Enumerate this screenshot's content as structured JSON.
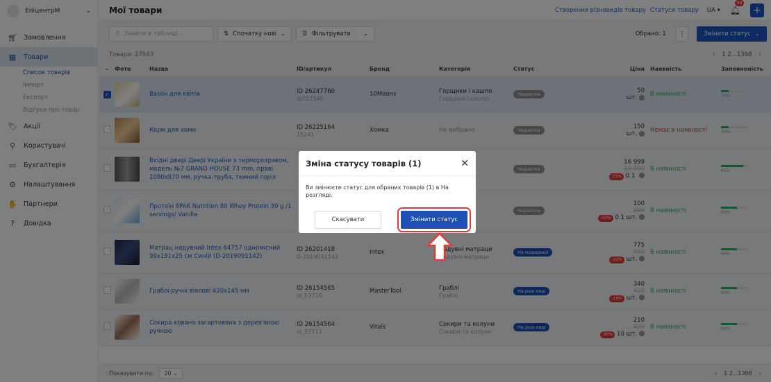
{
  "sidebar": {
    "brand": "ЕпіцентрМ",
    "items": [
      {
        "label": "Замовлення",
        "icon": "cart-icon"
      },
      {
        "label": "Товари",
        "icon": "box-icon",
        "active": true
      },
      {
        "label": "Акції",
        "icon": "tag-icon"
      },
      {
        "label": "Користувачі",
        "icon": "users-icon"
      },
      {
        "label": "Бухгалтерія",
        "icon": "wallet-icon"
      },
      {
        "label": "Налаштування",
        "icon": "gear-icon"
      },
      {
        "label": "Партнери",
        "icon": "handshake-icon"
      },
      {
        "label": "Довідка",
        "icon": "help-icon"
      }
    ],
    "subitems": [
      "Список товарів",
      "Імпорт",
      "Експорт",
      "Відгуки про товар"
    ]
  },
  "header": {
    "title": "Мої товари",
    "link1": "Створення різновидів товару",
    "link2": "Статуси товару",
    "lang": "UA",
    "badge": "99"
  },
  "toolbar": {
    "search_placeholder": "Знайти в таблиці...",
    "sort": "Спочатку нові",
    "filter": "Фільтрувати",
    "selected": "Обрано: 1",
    "change_status": "Змінити статус"
  },
  "countrow": {
    "total": "Товари: 27943",
    "pages": "1 2...1398"
  },
  "table": {
    "columns": [
      "Фото",
      "Назва",
      "ID/артикул",
      "Бренд",
      "Категорія",
      "Статус",
      "Ціна",
      "Наявність",
      "Заповненість"
    ],
    "rows": [
      {
        "name": "Вазон для квітів",
        "id": "ID 26247760",
        "sku": "apt12345",
        "brand": "10Moons",
        "cat1": "Горщики і кашпо",
        "cat2": "Горщики і кашпо",
        "status": "Чернетка",
        "price": "50",
        "old": "",
        "disc": "",
        "unit": "шт.",
        "qty": "",
        "avail": "В наявності",
        "fill": 0.3,
        "selected": true
      },
      {
        "name": "Корм для хоми",
        "id": "ID 26225164",
        "sku": "15241",
        "brand": "Хомка",
        "cat1": "Не вибрано",
        "cat2": "",
        "status": "Чернетка",
        "price": "150",
        "old": "",
        "disc": "",
        "unit": "шт.",
        "qty": "",
        "avail": "Немає в наявності",
        "fill": 0.3,
        "selected": false
      },
      {
        "name": "Вхідні двері Двері України з терморозривом, модель №7 GRAND HOUSE 73 mm, праві 2080x970 мм, ручка-труба, темний горіх",
        "id": "",
        "sku": "",
        "brand": "",
        "cat1": "",
        "cat2": "",
        "status": "Чернетка",
        "price": "16 999",
        "old": "19 999",
        "disc": "-15%",
        "unit": "",
        "qty": "0.1",
        "avail": "В наявності",
        "fill": 0.85,
        "selected": false
      },
      {
        "name": "Протеїн 6PAK Nutrition 80 Whey Protein 30 g /1 servings/ Vanilla",
        "id": "",
        "sku": "",
        "brand": "",
        "cat1": "",
        "cat2": "",
        "status": "Чернетка",
        "price": "100",
        "old": "200",
        "disc": "-50%",
        "unit": "шт.",
        "qty": "0.1",
        "avail": "В наявності",
        "fill": 0.6,
        "selected": false
      },
      {
        "name": "Матрац надувний Intex 64757 одномісний 99х191х25 см Синій (D-2019091142)",
        "id": "ID 26201418",
        "sku": "D-2019091142",
        "brand": "Intex",
        "cat1": "Надувні матраци",
        "cat2": "Надувні матраци",
        "status": "На модерації",
        "price": "775",
        "old": "995",
        "disc": "-22%",
        "unit": "шт.",
        "qty": "",
        "avail": "В наявності",
        "fill": 0.6,
        "selected": false
      },
      {
        "name": "Граблі ручні віялові 420х145 мм",
        "id": "ID 26154565",
        "sku": "id_53710",
        "brand": "MasterTool",
        "cat1": "Граблі",
        "cat2": "Граблі",
        "status": "На розгляді",
        "price": "340",
        "old": "420",
        "disc": "-19%",
        "unit": "шт.",
        "qty": "",
        "avail": "В наявності",
        "fill": 0.6,
        "selected": false
      },
      {
        "name": "Сокира кована загартована з дерев'яною ручкою",
        "id": "ID 26154564",
        "sku": "id_53711",
        "brand": "Vitals",
        "cat1": "Сокири та колуни",
        "cat2": "Сокири та колуни",
        "status": "На розгляді",
        "price": "210",
        "old": "420",
        "disc": "-50%",
        "unit": "шт.",
        "qty": "10",
        "avail": "В наявності",
        "fill": 0.6,
        "selected": false
      }
    ]
  },
  "footer": {
    "show_label": "Показувати по:",
    "per_page": "20",
    "pages": "1 2...1398"
  },
  "modal": {
    "title": "Зміна статусу товарів (1)",
    "body": "Ви змінюєте статус для обраних товарів (1) в На розгляді.",
    "cancel": "Скасувати",
    "confirm": "Змінити статус"
  },
  "colors": {
    "accent": "#1d57c2",
    "draft": "#8e8e8e",
    "moderation": "#1d4fb4",
    "review": "#1d4fb4",
    "in_stock": "#2eaa5c",
    "out_stock": "#e53935"
  }
}
